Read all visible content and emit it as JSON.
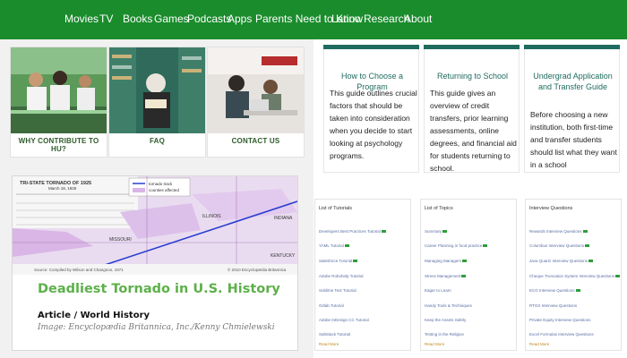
{
  "nav": {
    "items": [
      "Movies",
      "TV",
      "Books",
      "Games",
      "Podcasts",
      "Apps",
      "Parents Need to Know",
      "Latino",
      "Research",
      "About"
    ]
  },
  "colors": {
    "nav_bg": "#1a8c2c",
    "accent_teal": "#1f6b5f",
    "title_green": "#5db04a",
    "badge_green": "#2e9e3a",
    "link_blue": "#5b6fa3",
    "read_more": "#c08a1a"
  },
  "photo_cards": [
    {
      "label": "WHY CONTRIBUTE TO HU?"
    },
    {
      "label": "FAQ"
    },
    {
      "label": "CONTACT US"
    }
  ],
  "article": {
    "title": "Deadliest Tornado in U.S. History",
    "subtitle": "Article / World History",
    "credit": "Image: Encyclopædia Britannica, Inc./Kenny Chmielewski",
    "map": {
      "table_title": "TRI-STATE TORNADO OF 1925",
      "table_sub": "March 18, 1925",
      "legend_track": "tornado track",
      "legend_counties": "counties affected",
      "states": [
        "ILLINOIS",
        "MISSOURI",
        "INDIANA",
        "KENTUCKY"
      ],
      "source": "Source: Compiled by Wilson and Changnon, 1971",
      "copyright": "© 2010 Encyclopædia Britannica"
    }
  },
  "guides": [
    {
      "title": "How to Choose a Program",
      "body": "This guide outlines crucial factors that should be taken into consideration when you decide to start looking at psychology programs."
    },
    {
      "title": "Returning to School",
      "body": "This guide gives an overview of credit transfers, prior learning assessments, online degrees, and financial aid for students returning to school."
    },
    {
      "title": "Undergrad Application and Transfer Guide",
      "body": "Before choosing a new institution, both first-time and transfer students should list what they want in a school"
    }
  ],
  "lists": [
    {
      "heading": "List of Tutorials",
      "items": [
        {
          "text": "Developers Best Practices Tutorial",
          "badge": true
        },
        {
          "text": "YAML Tutorial",
          "badge": true
        },
        {
          "text": "Salesforce Tutorial",
          "badge": true
        },
        {
          "text": "Adobe Robohelp Tutorial",
          "badge": false
        },
        {
          "text": "Sublime Text Tutorial",
          "badge": false
        },
        {
          "text": "Gitlab Tutorial",
          "badge": false
        },
        {
          "text": "Adobe InDesign CC Tutorial",
          "badge": false
        },
        {
          "text": "SaltStack Tutorial",
          "badge": false
        }
      ],
      "read_more": "Read More"
    },
    {
      "heading": "List of Topics",
      "items": [
        {
          "text": "Summary",
          "badge": true
        },
        {
          "text": "Career Planning in food practice",
          "badge": true
        },
        {
          "text": "Managing Managers",
          "badge": true
        },
        {
          "text": "Stress Management",
          "badge": true
        },
        {
          "text": "Eager to Learn",
          "badge": false
        },
        {
          "text": "Handy Tools & Techniques",
          "badge": false
        },
        {
          "text": "Keep the Assets Safely",
          "badge": false
        },
        {
          "text": "Testing in the Religion",
          "badge": false
        }
      ],
      "read_more": "Read More"
    },
    {
      "heading": "Interview Questions",
      "items": [
        {
          "text": "Rewards Interview Questions",
          "badge": true
        },
        {
          "text": "Columbus Interview Questions",
          "badge": true
        },
        {
          "text": "Java Quartz Interview Questions",
          "badge": true
        },
        {
          "text": "Cheque Truncation System Interview Questions",
          "badge": true
        },
        {
          "text": "ECG Interview Questions",
          "badge": true
        },
        {
          "text": "RTGS Interview Questions",
          "badge": false
        },
        {
          "text": "Private Equity Interview Questions",
          "badge": false
        },
        {
          "text": "Excel Formulas Interview Questions",
          "badge": false
        }
      ],
      "read_more": "Read More"
    }
  ]
}
